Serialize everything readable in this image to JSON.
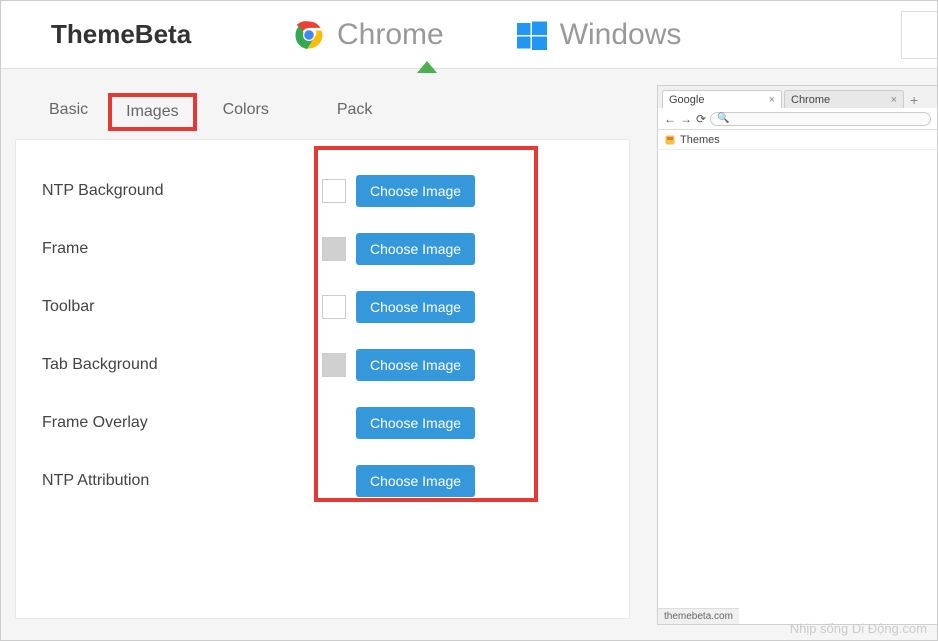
{
  "header": {
    "brand": "ThemeBeta",
    "nav": {
      "chrome": "Chrome",
      "windows": "Windows"
    }
  },
  "tabs": {
    "basic": "Basic",
    "images": "Images",
    "colors": "Colors",
    "pack": "Pack"
  },
  "rows": [
    {
      "label": "NTP Background",
      "swatch": "white",
      "button": "Choose Image"
    },
    {
      "label": "Frame",
      "swatch": "grey",
      "button": "Choose Image"
    },
    {
      "label": "Toolbar",
      "swatch": "white",
      "button": "Choose Image"
    },
    {
      "label": "Tab Background",
      "swatch": "grey",
      "button": "Choose Image"
    },
    {
      "label": "Frame Overlay",
      "swatch": null,
      "button": "Choose Image"
    },
    {
      "label": "NTP Attribution",
      "swatch": null,
      "button": "Choose Image"
    }
  ],
  "preview": {
    "tabs": [
      {
        "title": "Google"
      },
      {
        "title": "Chrome"
      }
    ],
    "bookmark": "Themes",
    "footer": "themebeta.com"
  },
  "watermark": "Nhịp sống Di Động.com"
}
